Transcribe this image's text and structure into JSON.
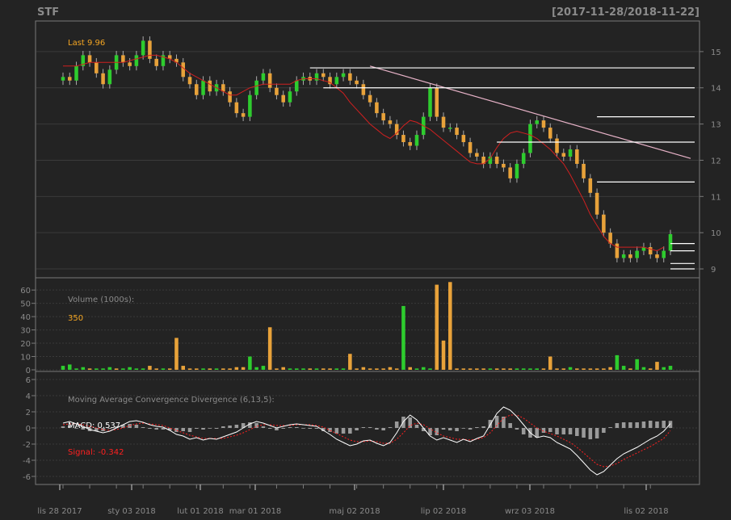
{
  "header": {
    "symbol": "STF",
    "range": "[2017-11-28/2018-11-22]"
  },
  "colors": {
    "background": "#232323",
    "panel_border": "#7a7a7a",
    "grid": "#3a3a3a",
    "up": "#2ecc2e",
    "down": "#e8a23a",
    "ma": "#d02020",
    "trend": "#e8b3c8",
    "level": "#ffffff",
    "macd": "#ffffff",
    "signal": "#ff2020",
    "hist": "#9a9a9a",
    "label_dim": "#8a8a8a",
    "label_last": "#f5a623"
  },
  "chart_data": [
    {
      "type": "line",
      "panel": "price",
      "last_label": "Last 9.96",
      "ylim": [
        8.8,
        15.8
      ],
      "yticks": [
        9,
        10,
        11,
        12,
        13,
        14,
        15
      ],
      "x_tick_labels": [
        "lis 28 2017",
        "sty 03 2018",
        "lut 01 2018",
        "mar 01 2018",
        "maj 02 2018",
        "lip 02 2018",
        "wrz 03 2018",
        "lis 02 2018"
      ],
      "close": [
        14.3,
        14.2,
        14.6,
        14.9,
        14.7,
        14.4,
        14.1,
        14.5,
        14.9,
        14.7,
        14.6,
        14.9,
        15.3,
        14.8,
        14.6,
        14.9,
        14.8,
        14.7,
        14.3,
        14.1,
        13.8,
        14.2,
        13.9,
        14.1,
        13.9,
        13.6,
        13.3,
        13.2,
        13.8,
        14.2,
        14.4,
        14.0,
        13.8,
        13.6,
        13.9,
        14.2,
        14.3,
        14.2,
        14.4,
        14.3,
        14.1,
        14.3,
        14.4,
        14.2,
        14.1,
        13.8,
        13.6,
        13.3,
        13.1,
        13.0,
        12.7,
        12.5,
        12.4,
        12.7,
        13.2,
        14.0,
        13.2,
        12.9,
        12.9,
        12.7,
        12.5,
        12.2,
        12.1,
        11.9,
        12.1,
        11.9,
        11.8,
        11.5,
        11.9,
        12.2,
        13.0,
        13.1,
        12.9,
        12.6,
        12.2,
        12.1,
        12.3,
        11.9,
        11.5,
        11.1,
        10.5,
        10.0,
        9.7,
        9.3,
        9.4,
        9.3,
        9.5,
        9.6,
        9.4,
        9.3,
        9.5,
        9.96
      ],
      "ma": [
        14.6,
        14.6,
        14.6,
        14.65,
        14.7,
        14.7,
        14.7,
        14.7,
        14.7,
        14.7,
        14.75,
        14.8,
        14.85,
        14.9,
        14.9,
        14.85,
        14.8,
        14.7,
        14.55,
        14.4,
        14.3,
        14.2,
        14.1,
        14.0,
        13.9,
        13.8,
        13.8,
        13.9,
        14.0,
        14.05,
        14.1,
        14.1,
        14.1,
        14.1,
        14.1,
        14.2,
        14.25,
        14.25,
        14.25,
        14.2,
        14.15,
        14.0,
        13.85,
        13.6,
        13.4,
        13.2,
        13.0,
        12.85,
        12.7,
        12.6,
        12.75,
        12.95,
        13.1,
        13.05,
        12.95,
        12.85,
        12.7,
        12.55,
        12.4,
        12.25,
        12.1,
        11.95,
        11.9,
        11.9,
        12.05,
        12.35,
        12.6,
        12.75,
        12.8,
        12.75,
        12.7,
        12.6,
        12.45,
        12.3,
        12.1,
        11.9,
        11.6,
        11.25,
        10.9,
        10.5,
        10.2,
        9.9,
        9.7,
        9.6,
        9.6,
        9.6,
        9.6,
        9.6,
        9.55,
        9.5,
        9.6
      ],
      "trendline": {
        "from": [
          46,
          14.6
        ],
        "to": [
          112,
          12.05
        ]
      },
      "levels": [
        {
          "from": 37,
          "to": 112,
          "value": 14.55
        },
        {
          "from": 39,
          "to": 112,
          "value": 14.0
        },
        {
          "from": 80,
          "to": 112,
          "value": 13.2
        },
        {
          "from": 65,
          "to": 112,
          "value": 12.5
        },
        {
          "from": 80,
          "to": 112,
          "value": 11.4
        },
        {
          "from": 91,
          "to": 112,
          "value": 9.7
        },
        {
          "from": 91,
          "to": 112,
          "value": 9.5
        },
        {
          "from": 91,
          "to": 112,
          "value": 9.15
        },
        {
          "from": 91,
          "to": 112,
          "value": 9.0
        }
      ]
    },
    {
      "type": "bar",
      "panel": "volume",
      "title": "Volume (1000s):",
      "last_value": "350",
      "ylim": [
        0,
        68
      ],
      "yticks": [
        0,
        10,
        20,
        30,
        40,
        50,
        60
      ],
      "values": [
        3,
        4,
        1,
        2,
        1,
        1,
        1,
        2,
        1,
        1,
        2,
        1,
        1,
        3,
        1,
        1,
        1,
        24,
        3,
        1,
        1,
        1,
        1,
        1,
        1,
        1,
        2,
        2,
        10,
        2,
        3,
        32,
        1,
        2,
        1,
        1,
        1,
        1,
        1,
        1,
        1,
        1,
        1,
        12,
        1,
        2,
        1,
        1,
        1,
        2,
        1,
        48,
        2,
        1,
        2,
        1,
        64,
        22,
        66,
        1,
        1,
        1,
        1,
        1,
        1,
        1,
        1,
        1,
        1,
        1,
        1,
        1,
        1,
        10,
        1,
        1,
        2,
        1,
        1,
        1,
        1,
        1,
        2,
        11,
        3,
        1,
        8,
        2,
        1,
        6,
        2,
        3
      ],
      "up": [
        1,
        1,
        1,
        1,
        0,
        1,
        1,
        1,
        0,
        1,
        1,
        1,
        1,
        0,
        0,
        1,
        0,
        0,
        0,
        0,
        0,
        1,
        0,
        1,
        0,
        0,
        0,
        0,
        1,
        1,
        1,
        0,
        0,
        0,
        1,
        1,
        1,
        0,
        1,
        0,
        0,
        1,
        1,
        0,
        0,
        0,
        0,
        0,
        0,
        0,
        0,
        1,
        0,
        1,
        1,
        1,
        0,
        0,
        0,
        0,
        0,
        0,
        0,
        0,
        1,
        0,
        0,
        0,
        1,
        1,
        1,
        1,
        0,
        0,
        0,
        0,
        1,
        0,
        0,
        0,
        0,
        0,
        0,
        1,
        1,
        0,
        1,
        1,
        0,
        0,
        1,
        1
      ]
    },
    {
      "type": "line",
      "panel": "macd",
      "title": "Moving Average Convergence Divergence (6,13,5):",
      "macd_label": "MACD: 0.537",
      "signal_label": "Signal: -0.342",
      "ylim": [
        -6.8,
        6.8
      ],
      "yticks": [
        -6,
        -4,
        -2,
        0,
        2,
        4,
        6
      ],
      "macd": [
        0.6,
        0.8,
        0.5,
        0.2,
        -0.2,
        -0.4,
        -0.6,
        -0.4,
        0.0,
        0.4,
        0.8,
        0.9,
        0.7,
        0.4,
        0.2,
        0.1,
        -0.3,
        -0.8,
        -1.0,
        -1.4,
        -1.2,
        -1.5,
        -1.3,
        -1.4,
        -1.1,
        -0.8,
        -0.5,
        0.0,
        0.5,
        0.8,
        0.6,
        0.3,
        0.0,
        0.2,
        0.4,
        0.5,
        0.4,
        0.3,
        0.2,
        -0.3,
        -0.8,
        -1.4,
        -1.8,
        -2.2,
        -2.0,
        -1.6,
        -1.5,
        -1.9,
        -2.2,
        -1.8,
        -0.6,
        0.8,
        1.6,
        1.0,
        0.0,
        -1.0,
        -1.5,
        -1.2,
        -1.5,
        -1.8,
        -1.4,
        -1.7,
        -1.3,
        -1.0,
        0.4,
        1.8,
        2.6,
        2.2,
        1.4,
        0.4,
        -0.6,
        -1.2,
        -1.0,
        -1.2,
        -1.8,
        -2.2,
        -2.6,
        -3.4,
        -4.3,
        -5.2,
        -5.8,
        -5.4,
        -4.6,
        -3.8,
        -3.2,
        -2.8,
        -2.4,
        -1.9,
        -1.4,
        -1.0,
        -0.4,
        0.537
      ],
      "signal": [
        0.4,
        0.5,
        0.5,
        0.4,
        0.2,
        0.0,
        -0.2,
        -0.3,
        -0.2,
        0.0,
        0.3,
        0.5,
        0.6,
        0.5,
        0.4,
        0.3,
        0.0,
        -0.3,
        -0.6,
        -0.9,
        -1.1,
        -1.3,
        -1.3,
        -1.3,
        -1.3,
        -1.1,
        -0.9,
        -0.6,
        -0.2,
        0.2,
        0.4,
        0.4,
        0.3,
        0.3,
        0.3,
        0.4,
        0.4,
        0.4,
        0.3,
        0.1,
        -0.3,
        -0.7,
        -1.1,
        -1.5,
        -1.7,
        -1.7,
        -1.6,
        -1.7,
        -1.9,
        -1.9,
        -1.4,
        -0.6,
        0.3,
        0.6,
        0.4,
        -0.1,
        -0.6,
        -1.0,
        -1.2,
        -1.4,
        -1.4,
        -1.5,
        -1.4,
        -1.2,
        -0.6,
        0.3,
        1.2,
        1.6,
        1.6,
        1.2,
        0.6,
        0.0,
        -0.4,
        -0.7,
        -1.0,
        -1.4,
        -1.8,
        -2.4,
        -3.1,
        -3.8,
        -4.5,
        -4.8,
        -4.7,
        -4.4,
        -3.9,
        -3.5,
        -3.1,
        -2.7,
        -2.3,
        -1.8,
        -1.3,
        -0.342
      ]
    }
  ]
}
